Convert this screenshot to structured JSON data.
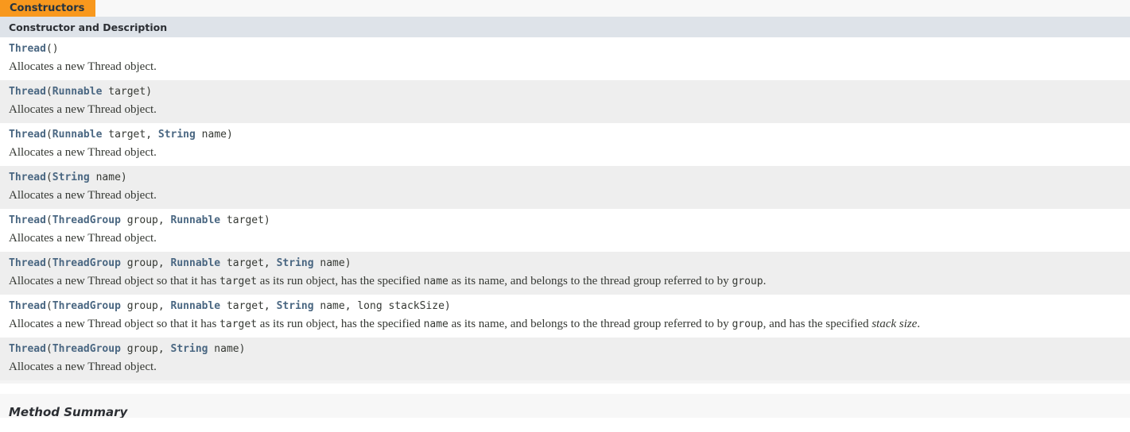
{
  "tab": {
    "label": "Constructors",
    "accent_color": "#f8981d"
  },
  "table": {
    "column_header": "Constructor and Description",
    "header_bg": "#dee3e9",
    "link_color": "#4a6782",
    "row_colors": [
      "#ffffff",
      "#eeeeee"
    ],
    "rows": [
      {
        "signature_parts": [
          {
            "text": "Thread",
            "link": true
          },
          {
            "text": "()",
            "link": false
          }
        ],
        "description_parts": [
          {
            "text": "Allocates a new Thread object.",
            "style": "plain"
          }
        ]
      },
      {
        "signature_parts": [
          {
            "text": "Thread",
            "link": true
          },
          {
            "text": "(",
            "link": false
          },
          {
            "text": "Runnable",
            "link": true
          },
          {
            "text": " target)",
            "link": false
          }
        ],
        "description_parts": [
          {
            "text": "Allocates a new Thread object.",
            "style": "plain"
          }
        ]
      },
      {
        "signature_parts": [
          {
            "text": "Thread",
            "link": true
          },
          {
            "text": "(",
            "link": false
          },
          {
            "text": "Runnable",
            "link": true
          },
          {
            "text": " target, ",
            "link": false
          },
          {
            "text": "String",
            "link": true
          },
          {
            "text": " name)",
            "link": false
          }
        ],
        "description_parts": [
          {
            "text": "Allocates a new Thread object.",
            "style": "plain"
          }
        ]
      },
      {
        "signature_parts": [
          {
            "text": "Thread",
            "link": true
          },
          {
            "text": "(",
            "link": false
          },
          {
            "text": "String",
            "link": true
          },
          {
            "text": " name)",
            "link": false
          }
        ],
        "description_parts": [
          {
            "text": "Allocates a new Thread object.",
            "style": "plain"
          }
        ]
      },
      {
        "signature_parts": [
          {
            "text": "Thread",
            "link": true
          },
          {
            "text": "(",
            "link": false
          },
          {
            "text": "ThreadGroup",
            "link": true
          },
          {
            "text": " group, ",
            "link": false
          },
          {
            "text": "Runnable",
            "link": true
          },
          {
            "text": " target)",
            "link": false
          }
        ],
        "description_parts": [
          {
            "text": "Allocates a new Thread object.",
            "style": "plain"
          }
        ]
      },
      {
        "signature_parts": [
          {
            "text": "Thread",
            "link": true
          },
          {
            "text": "(",
            "link": false
          },
          {
            "text": "ThreadGroup",
            "link": true
          },
          {
            "text": " group, ",
            "link": false
          },
          {
            "text": "Runnable",
            "link": true
          },
          {
            "text": " target, ",
            "link": false
          },
          {
            "text": "String",
            "link": true
          },
          {
            "text": " name)",
            "link": false
          }
        ],
        "description_parts": [
          {
            "text": "Allocates a new Thread object so that it has ",
            "style": "plain"
          },
          {
            "text": "target",
            "style": "code"
          },
          {
            "text": " as its run object, has the specified ",
            "style": "plain"
          },
          {
            "text": "name",
            "style": "code"
          },
          {
            "text": " as its name, and belongs to the thread group referred to by ",
            "style": "plain"
          },
          {
            "text": "group",
            "style": "code"
          },
          {
            "text": ".",
            "style": "plain"
          }
        ]
      },
      {
        "signature_parts": [
          {
            "text": "Thread",
            "link": true
          },
          {
            "text": "(",
            "link": false
          },
          {
            "text": "ThreadGroup",
            "link": true
          },
          {
            "text": " group, ",
            "link": false
          },
          {
            "text": "Runnable",
            "link": true
          },
          {
            "text": " target, ",
            "link": false
          },
          {
            "text": "String",
            "link": true
          },
          {
            "text": " name, long stackSize)",
            "link": false
          }
        ],
        "description_parts": [
          {
            "text": "Allocates a new Thread object so that it has ",
            "style": "plain"
          },
          {
            "text": "target",
            "style": "code"
          },
          {
            "text": " as its run object, has the specified ",
            "style": "plain"
          },
          {
            "text": "name",
            "style": "code"
          },
          {
            "text": " as its name, and belongs to the thread group referred to by ",
            "style": "plain"
          },
          {
            "text": "group",
            "style": "code"
          },
          {
            "text": ", and has the specified ",
            "style": "plain"
          },
          {
            "text": "stack size",
            "style": "italic"
          },
          {
            "text": ".",
            "style": "plain"
          }
        ]
      },
      {
        "signature_parts": [
          {
            "text": "Thread",
            "link": true
          },
          {
            "text": "(",
            "link": false
          },
          {
            "text": "ThreadGroup",
            "link": true
          },
          {
            "text": " group, ",
            "link": false
          },
          {
            "text": "String",
            "link": true
          },
          {
            "text": " name)",
            "link": false
          }
        ],
        "description_parts": [
          {
            "text": "Allocates a new Thread object.",
            "style": "plain"
          }
        ]
      }
    ]
  },
  "next_section": {
    "title": "Method Summary"
  }
}
